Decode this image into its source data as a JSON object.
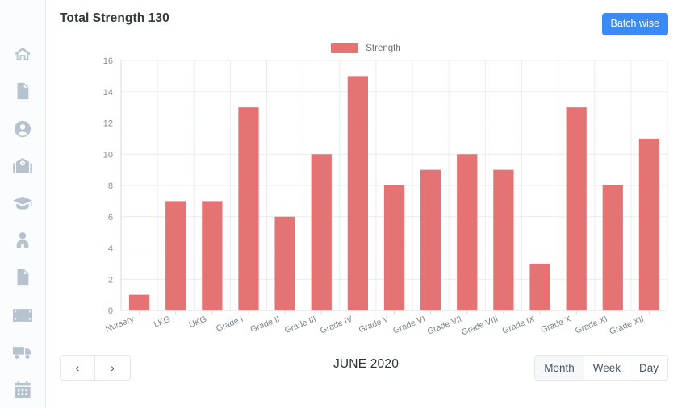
{
  "sidebar": {
    "items": [
      {
        "icon": "home-icon",
        "name": "sidebar-item-home"
      },
      {
        "icon": "file-icon",
        "name": "sidebar-item-file"
      },
      {
        "icon": "user-circle-icon",
        "name": "sidebar-item-profile"
      },
      {
        "icon": "school-icon",
        "name": "sidebar-item-school"
      },
      {
        "icon": "graduation-cap-icon",
        "name": "sidebar-item-academics"
      },
      {
        "icon": "staff-icon",
        "name": "sidebar-item-staff"
      },
      {
        "icon": "document-lines-icon",
        "name": "sidebar-item-reports"
      },
      {
        "icon": "money-icon",
        "name": "sidebar-item-finance"
      },
      {
        "icon": "truck-icon",
        "name": "sidebar-item-transport"
      },
      {
        "icon": "calendar-icon",
        "name": "sidebar-item-calendar"
      }
    ]
  },
  "header": {
    "title": "Total Strength 130",
    "batch_button": "Batch wise",
    "accent_color": "#3b8bf5"
  },
  "footer": {
    "prev_label": "‹",
    "next_label": "›",
    "period": "JUNE 2020",
    "ranges": [
      {
        "label": "Month",
        "active": true
      },
      {
        "label": "Week",
        "active": false
      },
      {
        "label": "Day",
        "active": false
      }
    ]
  },
  "chart_data": {
    "type": "bar",
    "title": "Total Strength 130",
    "xlabel": "",
    "ylabel": "",
    "ylim": [
      0,
      16
    ],
    "yticks": [
      0,
      2,
      4,
      6,
      8,
      10,
      12,
      14,
      16
    ],
    "grid": true,
    "legend": {
      "position": "top-center",
      "entries": [
        "Strength"
      ]
    },
    "series_color": "#e57373",
    "categories": [
      "Nursery",
      "LKG",
      "UKG",
      "Grade I",
      "Grade II",
      "Grade III",
      "Grade IV",
      "Grade V",
      "Grade VI",
      "Grade VII",
      "Grade VIII",
      "Grade IX",
      "Grade X",
      "Grade XI",
      "Grade XII"
    ],
    "series": [
      {
        "name": "Strength",
        "values": [
          1,
          7,
          7,
          13,
          6,
          10,
          15,
          8,
          9,
          10,
          9,
          3,
          13,
          8,
          11
        ]
      }
    ],
    "total": 130
  }
}
